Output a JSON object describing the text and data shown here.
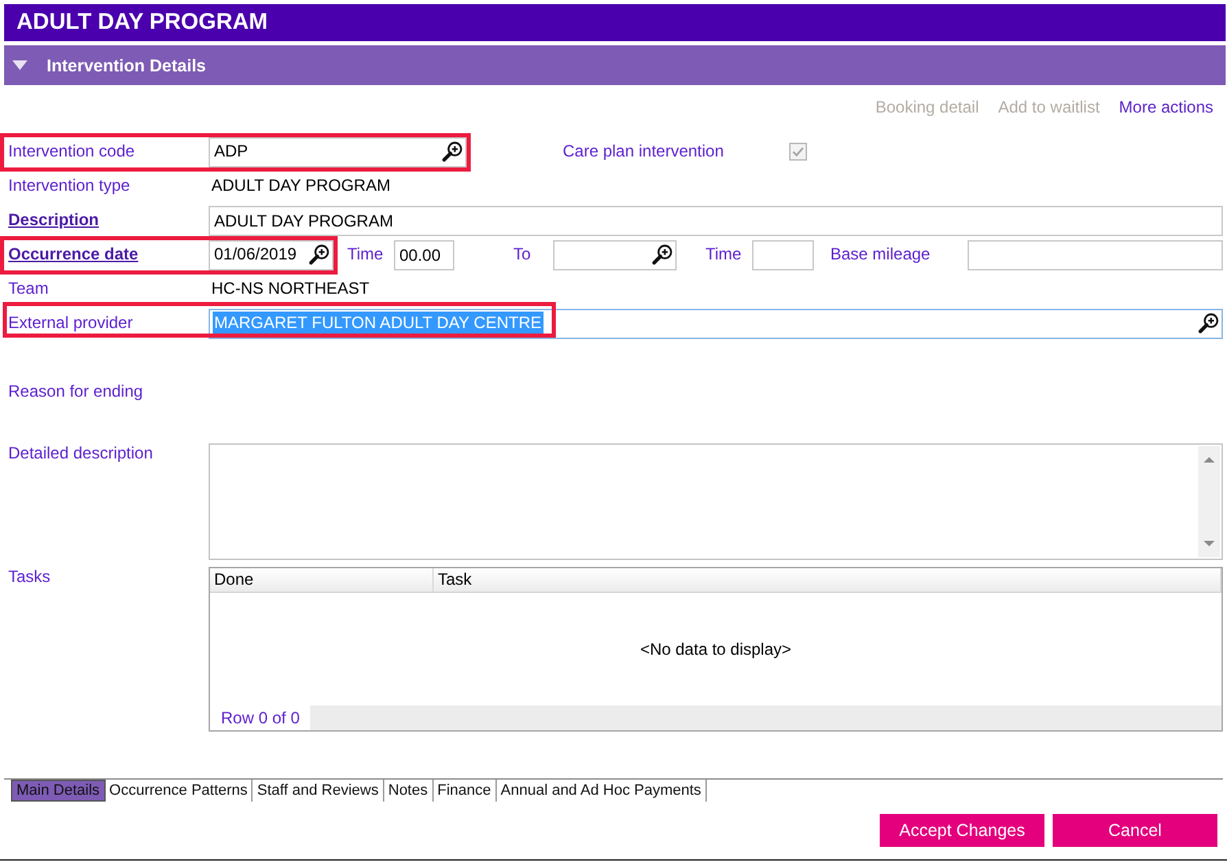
{
  "window": {
    "title": "ADULT DAY PROGRAM"
  },
  "section": {
    "title": "Intervention Details",
    "expanded": true
  },
  "actions": [
    {
      "label": "Booking detail",
      "disabled": true
    },
    {
      "label": "Add to waitlist",
      "disabled": true
    },
    {
      "label": "More actions",
      "disabled": false
    }
  ],
  "rows": [
    {
      "label": "Intervention code",
      "link": false,
      "highlighted": true,
      "items": [
        {
          "kind": "lookup",
          "value": "ADP",
          "selected": false
        },
        {
          "kind": "checkbox",
          "label": "Care plan intervention",
          "checked": true,
          "disabled": true
        }
      ]
    },
    {
      "label": "Intervention type",
      "link": false,
      "highlighted": false,
      "items": [
        {
          "kind": "text",
          "value": "ADULT DAY PROGRAM"
        }
      ]
    },
    {
      "label": "Description",
      "link": true,
      "highlighted": false,
      "items": [
        {
          "kind": "field",
          "value": "ADULT DAY PROGRAM"
        }
      ]
    },
    {
      "label": "Occurrence date",
      "link": true,
      "highlighted": true,
      "items": [
        {
          "kind": "lookup",
          "value": "01/06/2019",
          "selected": false
        },
        {
          "kind": "field",
          "label": "Time",
          "value": "00.00"
        },
        {
          "kind": "lookup",
          "label": "To",
          "selected": false
        },
        {
          "kind": "field",
          "label": "Time"
        },
        {
          "kind": "field",
          "label": "Base mileage"
        }
      ]
    },
    {
      "label": "Team",
      "link": false,
      "highlighted": false,
      "items": [
        {
          "kind": "text",
          "value": "HC-NS NORTHEAST"
        }
      ]
    },
    {
      "label": "External provider",
      "link": false,
      "highlighted": true,
      "items": [
        {
          "kind": "lookup",
          "value": "MARGARET FULTON ADULT DAY CENTRE",
          "selected": true
        }
      ]
    },
    {
      "label": "Reason for ending",
      "link": false,
      "highlighted": false
    },
    {
      "label": "Detailed description",
      "link": false,
      "highlighted": false,
      "items": [
        {
          "kind": "textarea"
        }
      ]
    },
    {
      "label": "Tasks",
      "link": false,
      "highlighted": false,
      "items": [
        {
          "kind": "grid",
          "columns": [
            "Done",
            "Task"
          ],
          "empty_message": "<No data to display>",
          "pager_text": "Row 0 of 0"
        }
      ]
    }
  ],
  "tabs": [
    {
      "label": "Main Details",
      "selected": true
    },
    {
      "label": "Occurrence Patterns",
      "selected": false
    },
    {
      "label": "Staff and Reviews",
      "selected": false
    },
    {
      "label": "Notes",
      "selected": false
    },
    {
      "label": "Finance",
      "selected": false
    },
    {
      "label": "Annual and Ad Hoc Payments",
      "selected": false
    }
  ],
  "buttons": [
    {
      "label": "Accept Changes"
    },
    {
      "label": "Cancel"
    }
  ]
}
